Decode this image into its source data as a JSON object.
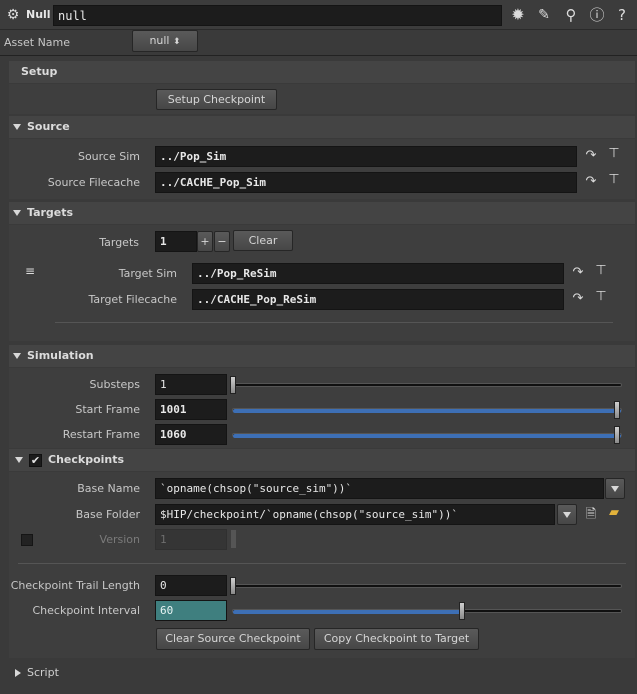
{
  "header": {
    "node_type": "Null",
    "node_name": "null",
    "asset_name_label": "Asset Name",
    "asset_name_value": "null"
  },
  "setup": {
    "title": "Setup",
    "setup_checkpoint_button": "Setup Checkpoint"
  },
  "source": {
    "title": "Source",
    "source_sim_label": "Source Sim",
    "source_sim_value": "../Pop_Sim",
    "source_filecache_label": "Source Filecache",
    "source_filecache_value": "../CACHE_Pop_Sim"
  },
  "targets": {
    "title": "Targets",
    "targets_label": "Targets",
    "targets_count": "1",
    "plus": "+",
    "minus": "−",
    "clear_button": "Clear",
    "target_sim_label": "Target Sim",
    "target_sim_value": "../Pop_ReSim",
    "target_filecache_label": "Target Filecache",
    "target_filecache_value": "../CACHE_Pop_ReSim"
  },
  "simulation": {
    "title": "Simulation",
    "substeps_label": "Substeps",
    "substeps_value": "1",
    "substeps_level": 0.0,
    "start_frame_label": "Start Frame",
    "start_frame_value": "1001",
    "start_frame_level": 1.0,
    "restart_frame_label": "Restart Frame",
    "restart_frame_value": "1060",
    "restart_frame_level": 1.0
  },
  "checkpoints": {
    "title": "Checkpoints",
    "enabled": true,
    "base_name_label": "Base Name",
    "base_name_value": "`opname(chsop(\"source_sim\"))`",
    "base_folder_label": "Base Folder",
    "base_folder_value": "$HIP/checkpoint/`opname(chsop(\"source_sim\"))`",
    "version_label": "Version",
    "version_value": "1",
    "trail_length_label": "Checkpoint Trail Length",
    "trail_length_value": "0",
    "trail_length_level": 0.0,
    "interval_label": "Checkpoint Interval",
    "interval_value": "60",
    "interval_level": 0.59,
    "clear_source_button": "Clear Source Checkpoint",
    "copy_button": "Copy Checkpoint to Target"
  },
  "script": {
    "title": "Script"
  },
  "colors": {
    "accent": "#3d6fb5",
    "interval_bg": "#3f7f7f"
  }
}
